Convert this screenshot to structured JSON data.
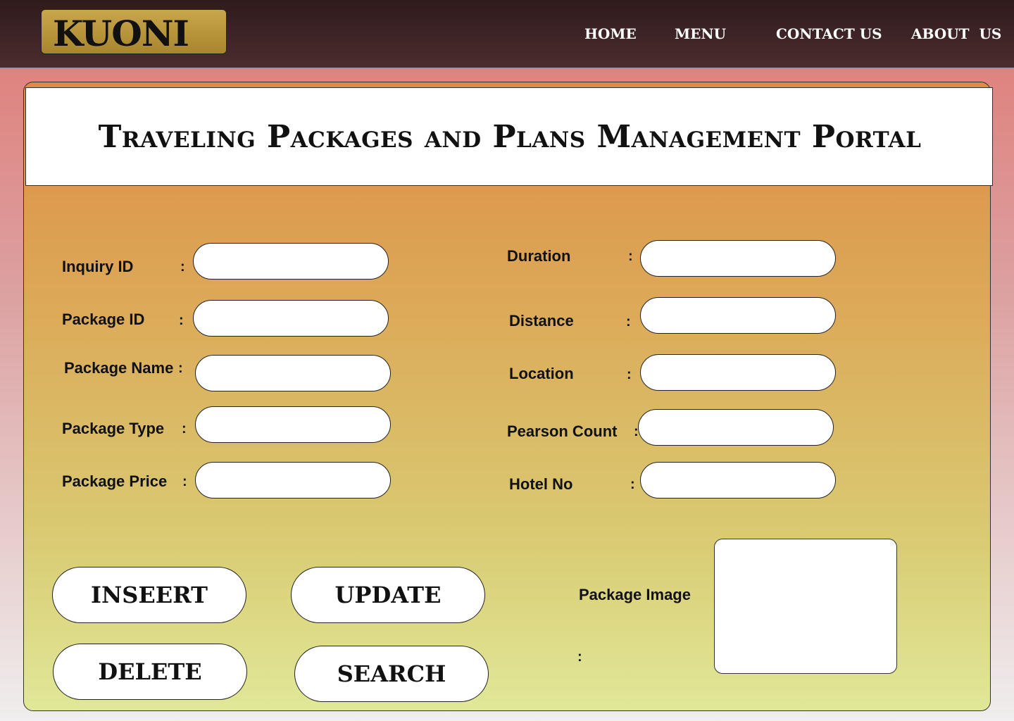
{
  "header": {
    "logo_text": "KUONI",
    "nav": [
      "HOME",
      "MENU",
      "CONTACT US",
      "ABOUT  US"
    ]
  },
  "page_title": "Traveling Packages and Plans Management Portal",
  "form": {
    "colon": ":",
    "left_fields": [
      {
        "label": "Inquiry ID",
        "value": ""
      },
      {
        "label": "Package ID",
        "value": ""
      },
      {
        "label": "Package Name",
        "value": ""
      },
      {
        "label": "Package Type",
        "value": ""
      },
      {
        "label": "Package Price",
        "value": ""
      }
    ],
    "right_fields": [
      {
        "label": "Duration",
        "value": ""
      },
      {
        "label": "Distance",
        "value": ""
      },
      {
        "label": "Location",
        "value": ""
      },
      {
        "label": "Pearson Count",
        "value": ""
      },
      {
        "label": "Hotel No",
        "value": ""
      }
    ],
    "image_label": "Package Image"
  },
  "buttons": {
    "insert": "INSEERT",
    "update": "UPDATE",
    "delete": "DELETE",
    "search": "SEARCH"
  }
}
